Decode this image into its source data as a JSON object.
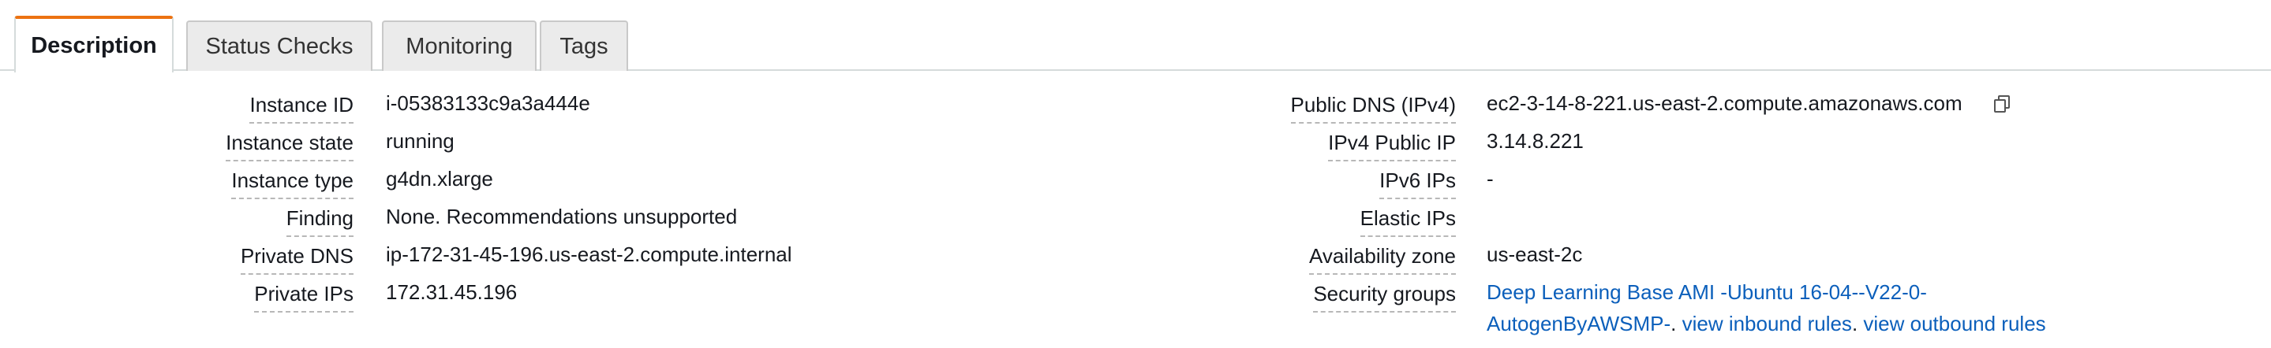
{
  "tabs": [
    {
      "label": "Description",
      "active": true
    },
    {
      "label": "Status Checks",
      "active": false
    },
    {
      "label": "Monitoring",
      "active": false
    },
    {
      "label": "Tags",
      "active": false
    }
  ],
  "left_details": [
    {
      "label": "Instance ID",
      "value": "i-05383133c9a3a444e"
    },
    {
      "label": "Instance state",
      "value": "running"
    },
    {
      "label": "Instance type",
      "value": "g4dn.xlarge"
    },
    {
      "label": "Finding",
      "value": "None. Recommendations unsupported"
    },
    {
      "label": "Private DNS",
      "value": "ip-172-31-45-196.us-east-2.compute.internal"
    },
    {
      "label": "Private IPs",
      "value": "172.31.45.196"
    }
  ],
  "right_details": [
    {
      "label": "Public DNS (IPv4)",
      "value": "ec2-3-14-8-221.us-east-2.compute.amazonaws.com"
    },
    {
      "label": "IPv4 Public IP",
      "value": "3.14.8.221"
    },
    {
      "label": "IPv6 IPs",
      "value": "-"
    },
    {
      "label": "Elastic IPs",
      "value": ""
    },
    {
      "label": "Availability zone",
      "value": "us-east-2c"
    },
    {
      "label": "Security groups",
      "value": ""
    }
  ],
  "security_groups": {
    "group_name_line1": "Deep Learning Base AMI -Ubuntu 16-04--V22-0-",
    "group_name_line2": "AutogenByAWSMP-",
    "sep1": ". ",
    "inbound_link": "view inbound rules",
    "sep2": ". ",
    "outbound_link": "view outbound rules"
  },
  "icons": {
    "copy": "copy-icon"
  },
  "colors": {
    "tab_accent": "#ec7211",
    "link": "#0b5fbb"
  }
}
